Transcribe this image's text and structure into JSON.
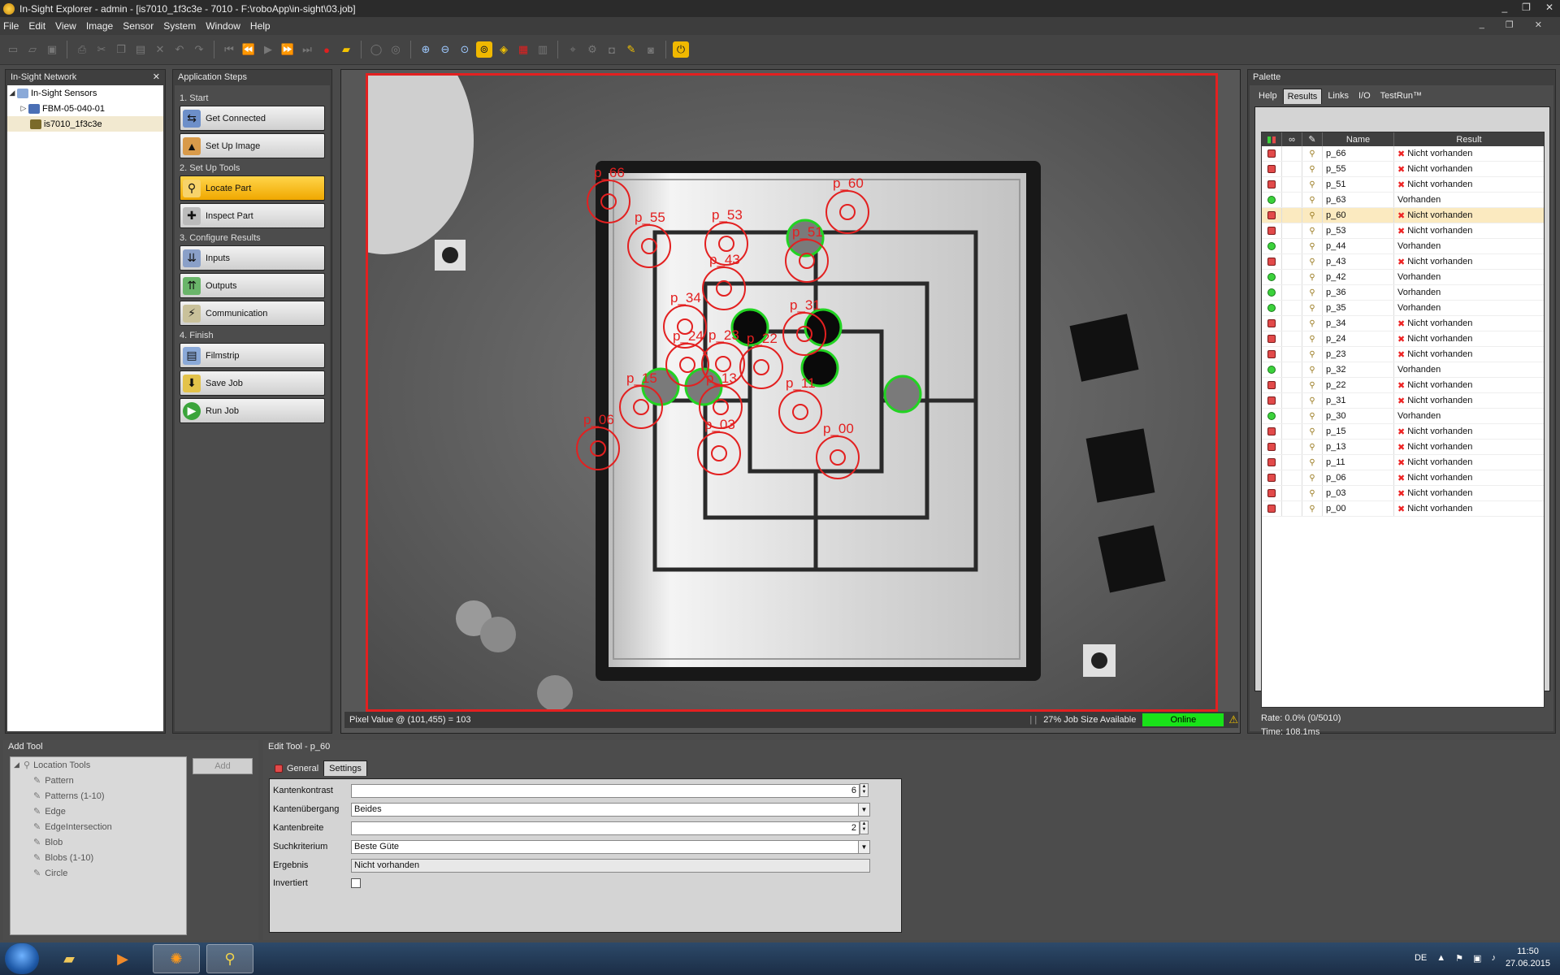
{
  "window": {
    "title": "In-Sight Explorer - admin - [is7010_1f3c3e - 7010 - F:\\roboApp\\in-sight\\03.job]",
    "controls": [
      "_",
      "❐",
      "✕"
    ]
  },
  "menu": [
    "File",
    "Edit",
    "View",
    "Image",
    "Sensor",
    "System",
    "Window",
    "Help"
  ],
  "mdi_controls": [
    "_",
    "❐",
    "✕"
  ],
  "network": {
    "title": "In-Sight Network",
    "close": "✕",
    "items": [
      {
        "label": "In-Sight Sensors",
        "expand": "◢"
      },
      {
        "label": "FBM-05-040-01",
        "expand": "▷"
      },
      {
        "label": "is7010_1f3c3e",
        "expand": ""
      }
    ]
  },
  "steps": {
    "title": "Application Steps",
    "groups": [
      {
        "label": "1. Start",
        "buttons": [
          "Get Connected",
          "Set Up Image"
        ]
      },
      {
        "label": "2. Set Up Tools",
        "buttons": [
          "Locate Part",
          "Inspect Part"
        ]
      },
      {
        "label": "3. Configure Results",
        "buttons": [
          "Inputs",
          "Outputs",
          "Communication"
        ]
      },
      {
        "label": "4. Finish",
        "buttons": [
          "Filmstrip",
          "Save Job",
          "Run Job"
        ]
      }
    ]
  },
  "image": {
    "labels": [
      {
        "text": "p_66",
        "ok": false
      },
      {
        "text": "p_60",
        "ok": false
      },
      {
        "text": "p_55",
        "ok": false
      },
      {
        "text": "p_53",
        "ok": false
      },
      {
        "text": "p_51",
        "ok": false
      },
      {
        "text": "p_43",
        "ok": false
      },
      {
        "text": "p_34",
        "ok": false
      },
      {
        "text": "p_31",
        "ok": false
      },
      {
        "text": "p_24",
        "ok": false
      },
      {
        "text": "p_23",
        "ok": false
      },
      {
        "text": "p_22",
        "ok": false
      },
      {
        "text": "p_15",
        "ok": false
      },
      {
        "text": "p_13",
        "ok": false
      },
      {
        "text": "p_11",
        "ok": false
      },
      {
        "text": "p_06",
        "ok": false
      },
      {
        "text": "p_03",
        "ok": false
      },
      {
        "text": "p_00",
        "ok": false
      }
    ]
  },
  "status": {
    "pixel_value": "Pixel Value @ (101,455) = 103",
    "job_size": "27% Job Size Available",
    "online": "Online"
  },
  "palette": {
    "title": "Palette",
    "tabs": [
      "Help",
      "Results",
      "Links",
      "I/O",
      "TestRun™"
    ],
    "columns": [
      "Name",
      "Result"
    ],
    "rows": [
      {
        "name": "p_66",
        "result": "Nicht vorhanden",
        "ok": false
      },
      {
        "name": "p_55",
        "result": "Nicht vorhanden",
        "ok": false
      },
      {
        "name": "p_51",
        "result": "Nicht vorhanden",
        "ok": false
      },
      {
        "name": "p_63",
        "result": "Vorhanden",
        "ok": true
      },
      {
        "name": "p_60",
        "result": "Nicht vorhanden",
        "ok": false
      },
      {
        "name": "p_53",
        "result": "Nicht vorhanden",
        "ok": false
      },
      {
        "name": "p_44",
        "result": "Vorhanden",
        "ok": true
      },
      {
        "name": "p_43",
        "result": "Nicht vorhanden",
        "ok": false
      },
      {
        "name": "p_42",
        "result": "Vorhanden",
        "ok": true
      },
      {
        "name": "p_36",
        "result": "Vorhanden",
        "ok": true
      },
      {
        "name": "p_35",
        "result": "Vorhanden",
        "ok": true
      },
      {
        "name": "p_34",
        "result": "Nicht vorhanden",
        "ok": false
      },
      {
        "name": "p_24",
        "result": "Nicht vorhanden",
        "ok": false
      },
      {
        "name": "p_23",
        "result": "Nicht vorhanden",
        "ok": false
      },
      {
        "name": "p_32",
        "result": "Vorhanden",
        "ok": true
      },
      {
        "name": "p_22",
        "result": "Nicht vorhanden",
        "ok": false
      },
      {
        "name": "p_31",
        "result": "Nicht vorhanden",
        "ok": false
      },
      {
        "name": "p_30",
        "result": "Vorhanden",
        "ok": true
      },
      {
        "name": "p_15",
        "result": "Nicht vorhanden",
        "ok": false
      },
      {
        "name": "p_13",
        "result": "Nicht vorhanden",
        "ok": false
      },
      {
        "name": "p_11",
        "result": "Nicht vorhanden",
        "ok": false
      },
      {
        "name": "p_06",
        "result": "Nicht vorhanden",
        "ok": false
      },
      {
        "name": "p_03",
        "result": "Nicht vorhanden",
        "ok": false
      },
      {
        "name": "p_00",
        "result": "Nicht vorhanden",
        "ok": false
      }
    ],
    "rate": "Rate: 0.0% (0/5010)",
    "time": "Time: 108.1ms"
  },
  "add_tool": {
    "title": "Add Tool",
    "add_label": "Add",
    "root": "Location Tools",
    "items": [
      "Pattern",
      "Patterns (1-10)",
      "Edge",
      "EdgeIntersection",
      "Blob",
      "Blobs (1-10)",
      "Circle"
    ]
  },
  "edit_tool": {
    "title": "Edit Tool - p_60",
    "tabs": [
      "General",
      "Settings"
    ],
    "fields": [
      {
        "label": "Kantenkontrast",
        "value": "6"
      },
      {
        "label": "Kantenübergang",
        "value": "Beides"
      },
      {
        "label": "Kantenbreite",
        "value": "2"
      },
      {
        "label": "Suchkriterium",
        "value": "Beste Güte"
      },
      {
        "label": "Ergebnis",
        "value": "Nicht vorhanden"
      },
      {
        "label": "Invertiert",
        "value": ""
      }
    ]
  },
  "taskbar": {
    "lang": "DE",
    "time": "11:50",
    "date": "27.06.2015"
  },
  "colors": {
    "accent": "#f0b800",
    "fail": "#e32020",
    "pass": "#3bd23b",
    "online": "#19e219"
  }
}
